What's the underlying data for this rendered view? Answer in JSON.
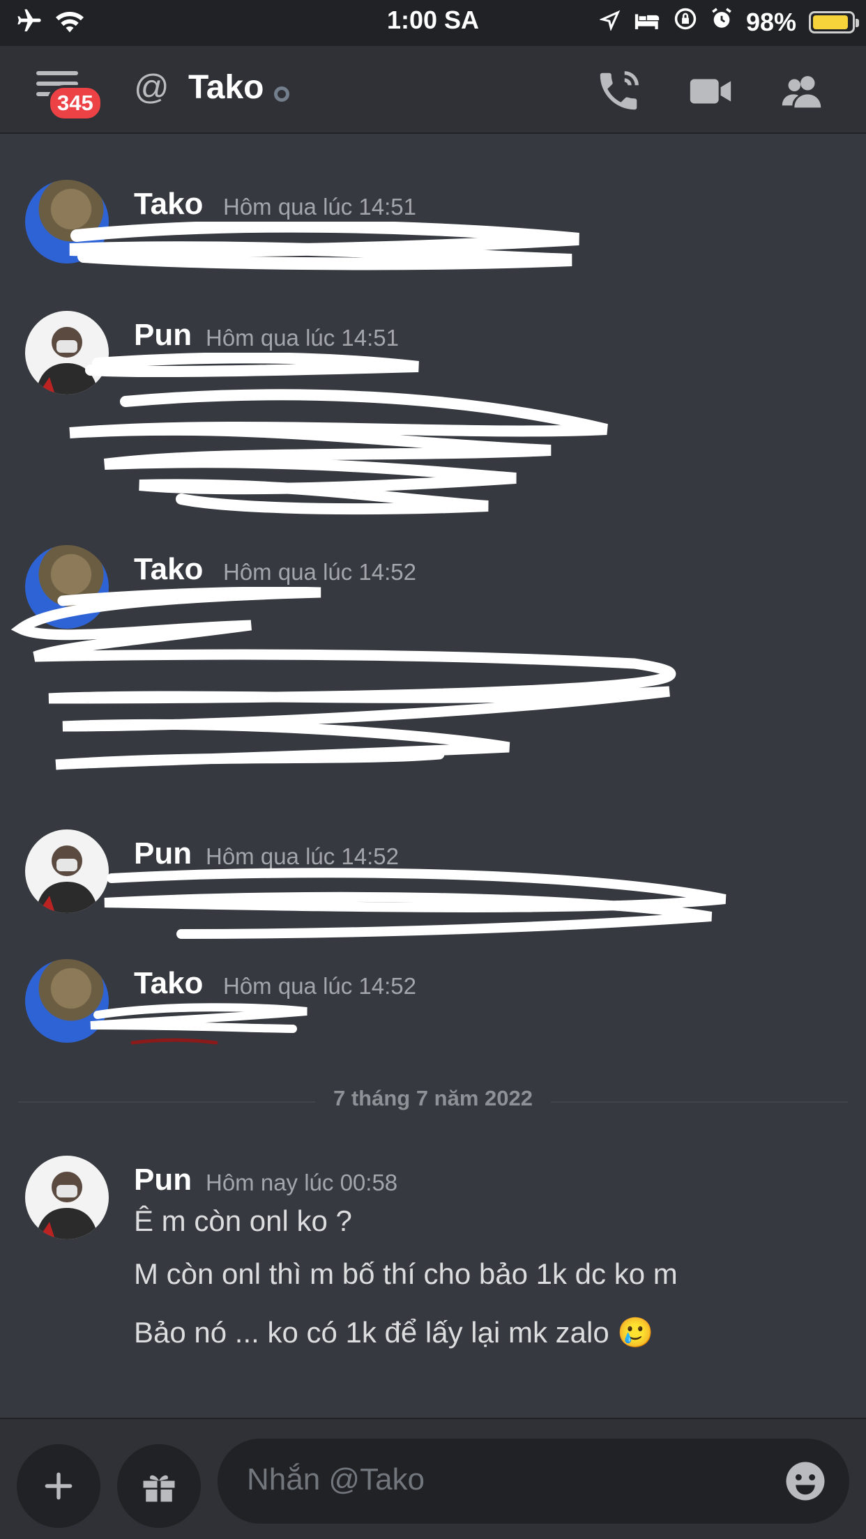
{
  "status_bar": {
    "time": "1:00 SA",
    "battery": "98%"
  },
  "header": {
    "badge": "345",
    "at_symbol": "@",
    "channel": "Tako"
  },
  "messages": [
    {
      "author": "Tako",
      "time": "Hôm qua lúc 14:51"
    },
    {
      "author": "Pun",
      "time": "Hôm qua lúc 14:51"
    },
    {
      "author": "Tako",
      "time": "Hôm qua lúc 14:52"
    },
    {
      "author": "Pun",
      "time": "Hôm qua lúc 14:52"
    },
    {
      "author": "Tako",
      "time": "Hôm qua lúc 14:52"
    },
    {
      "author": "Pun",
      "time": "Hôm nay lúc 00:58",
      "lines": [
        "Ê m còn onl ko ?",
        "M còn onl thì m bố thí cho bảo 1k dc ko m",
        "Bảo nó ... ko có 1k để lấy lại mk zalo 🥲"
      ]
    }
  ],
  "date_divider": "7 tháng 7 năm 2022",
  "composer": {
    "placeholder": "Nhắn @Tako"
  },
  "icons": {
    "airplane": "airplane-icon",
    "wifi": "wifi-icon",
    "location": "location-icon",
    "bed": "bed-icon",
    "lock-rotation": "lock-rotation-icon",
    "alarm": "alarm-icon",
    "menu": "menu-icon",
    "call": "call-icon",
    "video": "video-icon",
    "members": "members-icon",
    "plus": "plus-icon",
    "gift": "gift-icon",
    "emoji": "emoji-icon"
  },
  "colors": {
    "background": "#36393f",
    "header": "#2f3136",
    "badge": "#ed4245",
    "battery": "#f6d33b"
  }
}
